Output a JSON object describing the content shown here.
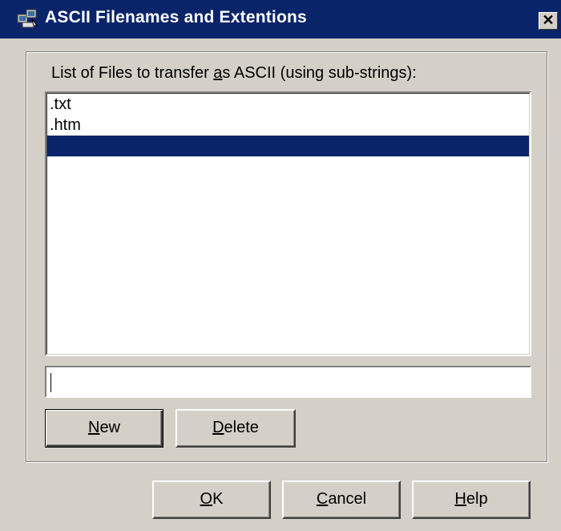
{
  "window": {
    "title": "ASCII Filenames and Extentions",
    "close_glyph": "✕"
  },
  "list": {
    "caption_pre": "List of Files to transfer ",
    "caption_accel": "a",
    "caption_post": "s ASCII (using sub-strings):",
    "items": [
      {
        "label": ".txt"
      },
      {
        "label": ".htm"
      },
      {
        "label": ""
      }
    ],
    "selected_index": 2
  },
  "entry": {
    "value": ""
  },
  "buttons": {
    "new": {
      "accel": "N",
      "rest": "ew"
    },
    "delete": {
      "accel": "D",
      "rest": "elete"
    },
    "ok": {
      "accel": "O",
      "rest": "K"
    },
    "cancel": {
      "accel": "C",
      "rest": "ancel"
    },
    "help": {
      "accel": "H",
      "rest": "elp"
    }
  },
  "colors": {
    "title_bar": "#0a246a",
    "selection": "#0a246a",
    "face": "#d4d0c8"
  },
  "icons": {
    "title": "network-computers-icon"
  }
}
